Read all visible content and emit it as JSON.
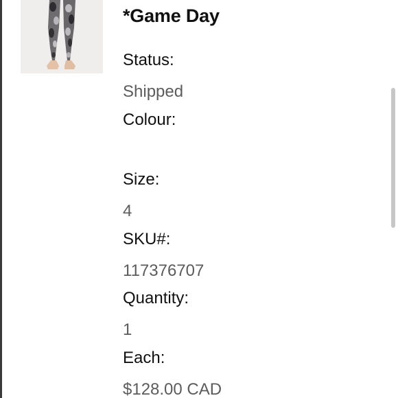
{
  "product": {
    "name": "*Game Day",
    "image_icon": "leggings-photo"
  },
  "fields": {
    "status": {
      "label": "Status:",
      "value": "Shipped"
    },
    "colour": {
      "label": "Colour:",
      "value": ""
    },
    "size": {
      "label": "Size:",
      "value": "4"
    },
    "sku": {
      "label": "SKU#:",
      "value": "117376707"
    },
    "quantity": {
      "label": "Quantity:",
      "value": "1"
    },
    "each": {
      "label": "Each:",
      "value": "$128.00 CAD"
    }
  },
  "colors": {
    "label_text": "#111111",
    "value_text": "#5c5c5c",
    "scrollbar": "#c7c7c7"
  }
}
